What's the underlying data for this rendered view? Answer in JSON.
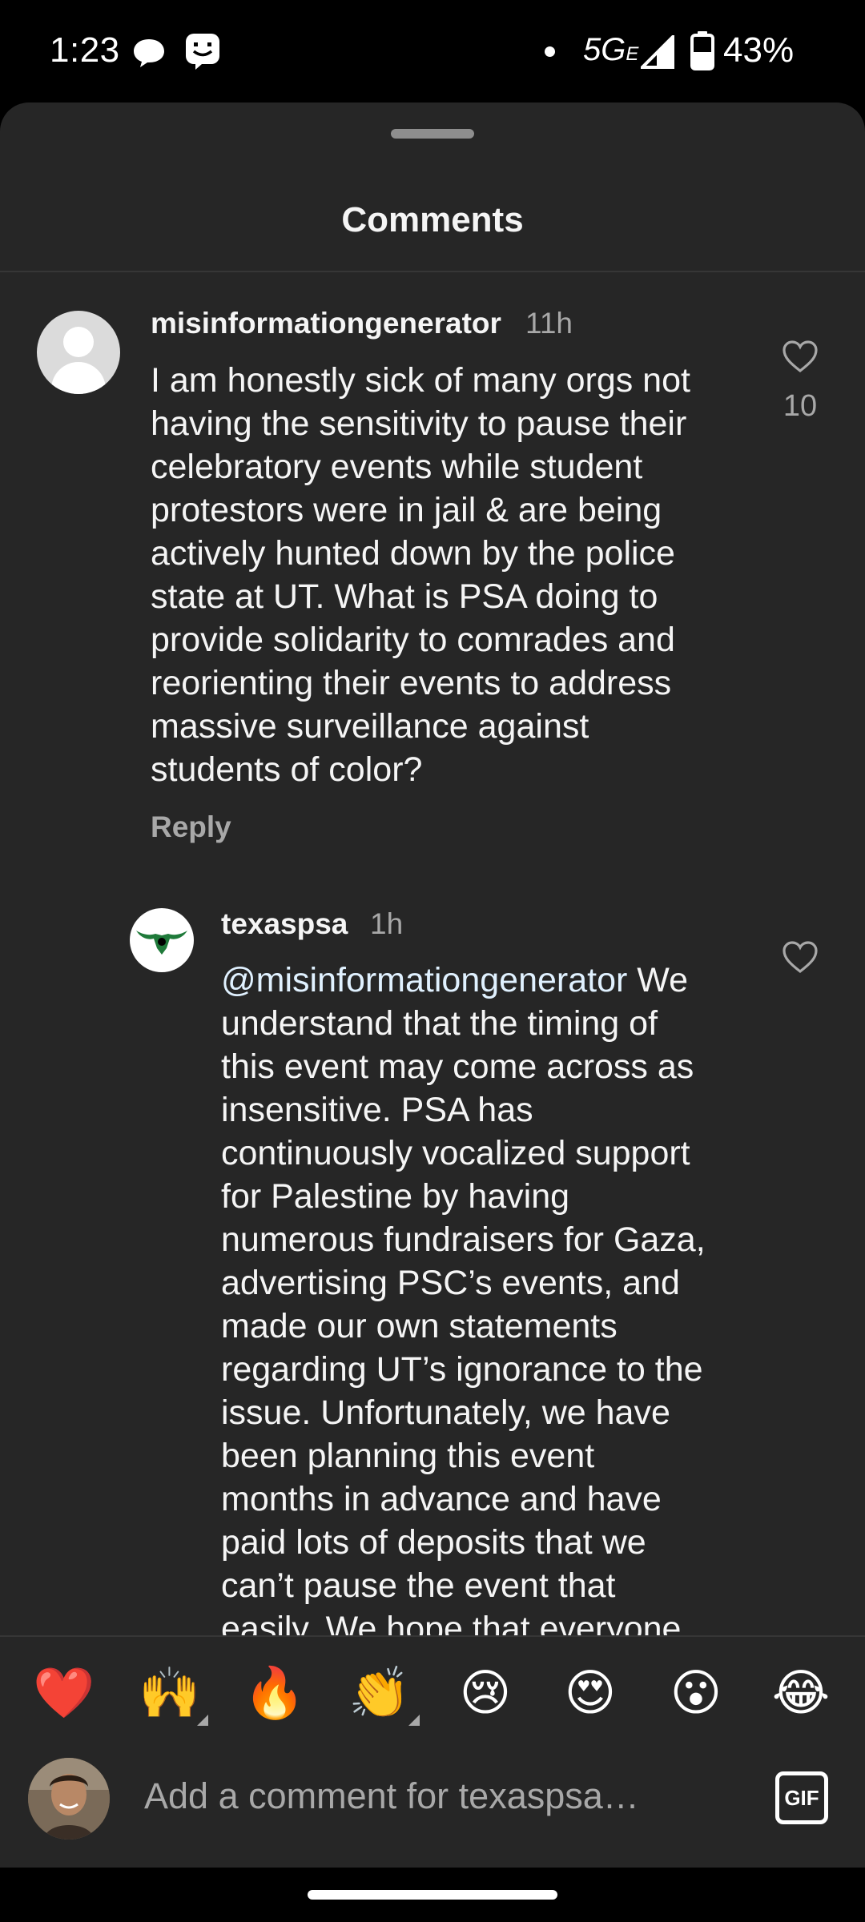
{
  "status_bar": {
    "time": "1:23",
    "network": "5G",
    "network_sub": "E",
    "battery": "43%"
  },
  "sheet": {
    "title": "Comments"
  },
  "comments": [
    {
      "username": "misinformationgenerator",
      "time": "11h",
      "text": "I am honestly sick of many orgs not\nhaving the sensitivity to pause their\ncelebratory events while student\nprotestors were in jail & are being\nactively hunted down by the police\nstate at UT. What is PSA doing to\nprovide solidarity to comrades and\nreorienting their events to address\nmassive surveillance against\nstudents of color?",
      "likes": "10",
      "reply_label": "Reply"
    },
    {
      "username": "texaspsa",
      "time": "1h",
      "mention": "@misinformationgenerator",
      "text": " We\nunderstand that the timing of\nthis event may come across as\ninsensitive. PSA has\ncontinuously vocalized support\nfor Palestine by having\nnumerous fundraisers for Gaza,\nadvertising PSC’s events, and\nmade our own statements\nregarding UT’s ignorance to the\nissue. Unfortunately, we have\nbeen planning this event\nmonths in advance and have\npaid lots of deposits that we\ncan’t pause the event that\neasily. We hope that everyone"
    }
  ],
  "composer": {
    "emojis": [
      "❤️",
      "🙌",
      "🔥",
      "👏",
      "😢",
      "😍",
      "😮",
      "😂"
    ],
    "placeholder": "Add a comment for texaspsa…",
    "gif_label": "GIF"
  }
}
